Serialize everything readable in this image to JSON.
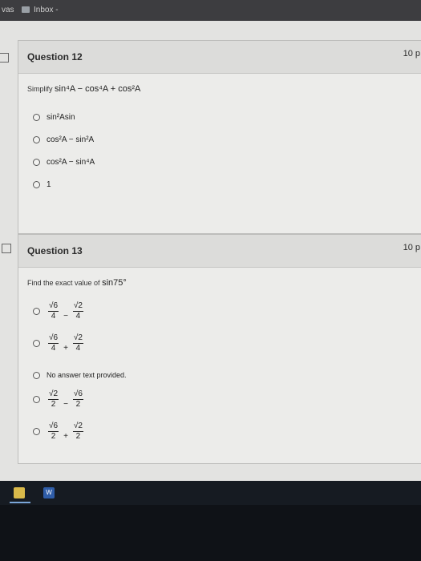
{
  "browser": {
    "tab_left": "vas",
    "tab_inbox": "Inbox -"
  },
  "q12": {
    "title": "Question 12",
    "points": "10 p",
    "prompt_label": "Simplify",
    "prompt_expr": "sin⁴A − cos⁴A + cos²A",
    "options": [
      "sin²Asin",
      "cos²A − sin²A",
      "cos²A − sin⁴A",
      "1"
    ]
  },
  "q13": {
    "title": "Question 13",
    "points": "10 p",
    "prompt_label": "Find the exact value of",
    "prompt_expr": "sin75°",
    "options": [
      {
        "n1": "√6",
        "d1": "4",
        "op": "−",
        "n2": "√2",
        "d2": "4"
      },
      {
        "n1": "√6",
        "d1": "4",
        "op": "+",
        "n2": "√2",
        "d2": "4"
      },
      {
        "text": "No answer text provided."
      },
      {
        "n1": "√2",
        "d1": "2",
        "op": "−",
        "n2": "√6",
        "d2": "2"
      },
      {
        "n1": "√6",
        "d1": "2",
        "op": "+",
        "n2": "√2",
        "d2": "2"
      }
    ]
  },
  "taskbar": {
    "word_label": "W"
  }
}
